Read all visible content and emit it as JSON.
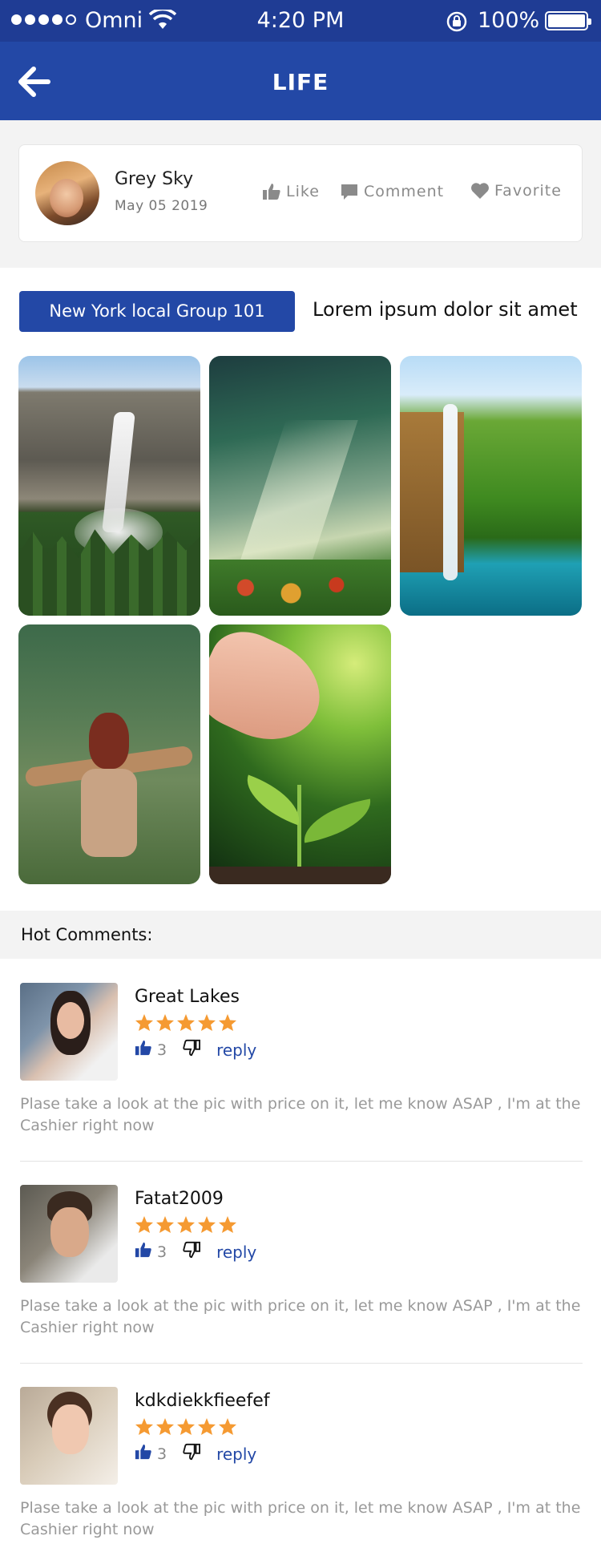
{
  "status_bar": {
    "carrier": "Omni",
    "time": "4:20 PM",
    "battery": "100%"
  },
  "nav": {
    "title": "LIFE"
  },
  "post": {
    "author_name": "Grey Sky",
    "date": "May 05 2019",
    "actions": {
      "like": "Like",
      "comment": "Comment",
      "favorite": "Favorite"
    },
    "group": "New York local Group 101",
    "text": "Lorem ipsum dolor sit amet"
  },
  "hot_comments": {
    "heading": "Hot Comments:",
    "items": [
      {
        "name": "Great Lakes",
        "rating": 5,
        "likes": "3",
        "reply": "reply",
        "text": "Plase take a look at the pic with price on it, let me know ASAP , I'm at the Cashier right now"
      },
      {
        "name": "Fatat2009",
        "rating": 5,
        "likes": "3",
        "reply": "reply",
        "text": "Plase take a look at the pic with price on it, let me know ASAP , I'm at the Cashier right now"
      },
      {
        "name": "kdkdiekkfieefef",
        "rating": 5,
        "likes": "3",
        "reply": "reply",
        "text": "Plase take a look at the pic with price on it, let me know ASAP , I'm at the Cashier right now"
      }
    ]
  },
  "colors": {
    "primary": "#2348a6",
    "status_bar": "#1f3c94",
    "star": "#f59a32",
    "muted": "#999999"
  }
}
